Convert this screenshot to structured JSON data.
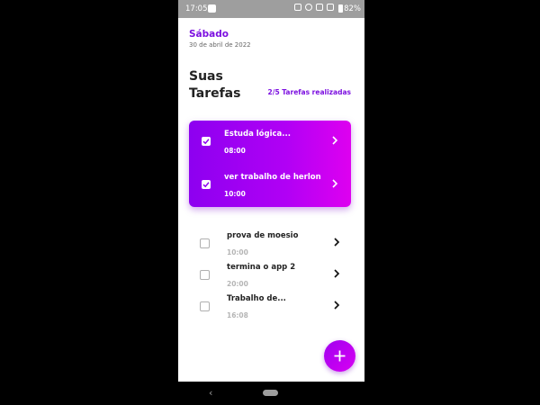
{
  "status_bar": {
    "time": "17:05",
    "battery_text": "82%"
  },
  "header": {
    "day": "Sábado",
    "date": "30 de abril de 2022",
    "title_line1": "Suas",
    "title_line2": "Tarefas",
    "progress_text": "2/5 Tarefas realizadas"
  },
  "completed_tasks": [
    {
      "name": "Estuda lógica...",
      "time": "08:00",
      "checked": true
    },
    {
      "name": "ver trabalho de herlon",
      "time": "10:00",
      "checked": true
    }
  ],
  "pending_tasks": [
    {
      "name": "prova de moesio",
      "time": "10:00",
      "checked": false
    },
    {
      "name": "termina o app 2",
      "time": "20:00",
      "checked": false
    },
    {
      "name": "Trabalho de...",
      "time": "16:08",
      "checked": false
    }
  ],
  "fab": {
    "icon": "plus-icon"
  },
  "nav": {
    "back_icon": "back-icon",
    "home_icon": "home-pill-icon"
  },
  "colors": {
    "accent": "#7c10e0",
    "gradient_start": "#8d00f0",
    "gradient_end": "#de00f0",
    "muted_time": "#b5b5b5"
  }
}
